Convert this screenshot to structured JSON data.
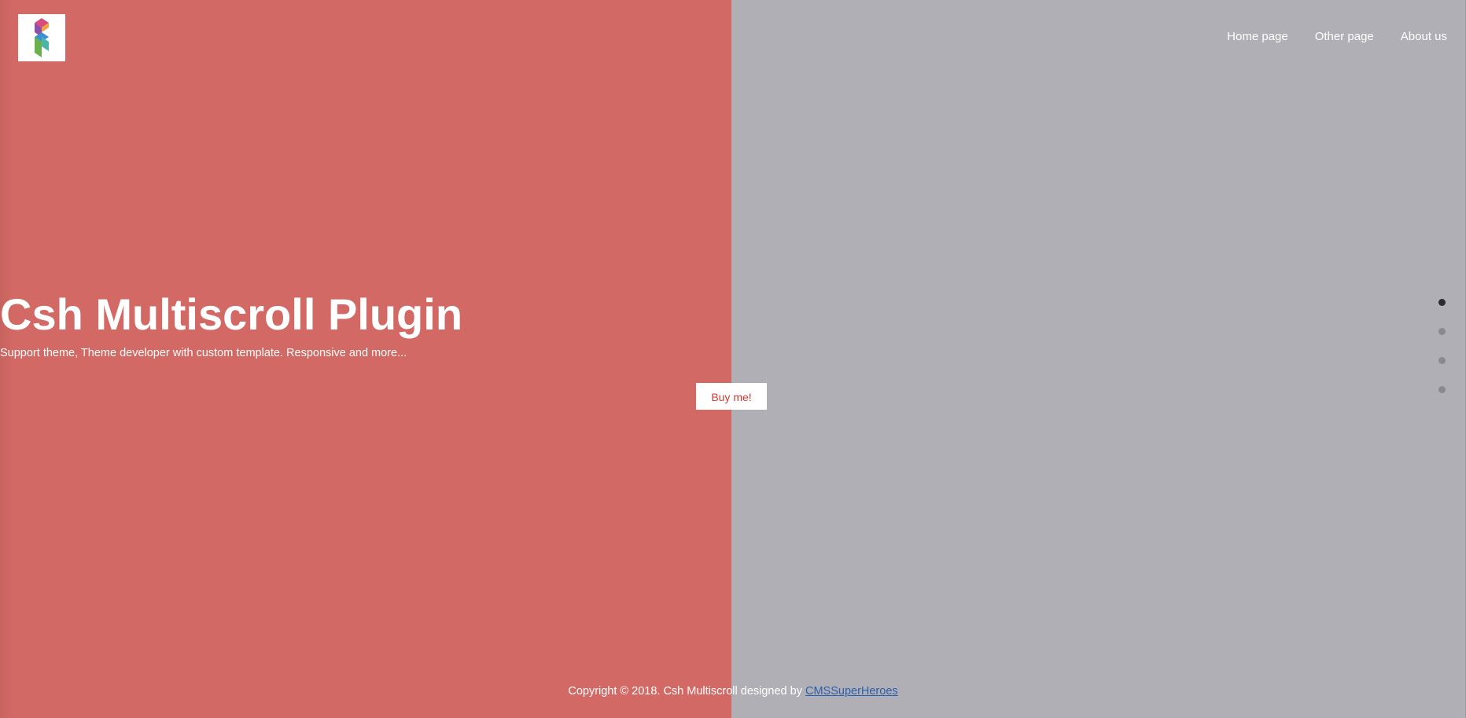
{
  "logo": {
    "icon": "brand-logo-icon"
  },
  "nav": {
    "items": [
      {
        "label": "Home page"
      },
      {
        "label": "Other page"
      },
      {
        "label": "About us"
      }
    ]
  },
  "hero": {
    "title": "Csh Multiscroll Plugin",
    "subtitle": "Support theme, Theme developer with custom template. Responsive and more...",
    "button_label": "Buy me!"
  },
  "pagination": {
    "count": 4,
    "active_index": 0
  },
  "footer": {
    "text": "Copyright © 2018. Csh Multiscroll designed by ",
    "link_label": "CMSSuperHeroes"
  },
  "colors": {
    "left_panel": "#d36964",
    "right_panel": "#b0afb5",
    "button_text": "#d03a34",
    "link": "#2a5fae"
  }
}
